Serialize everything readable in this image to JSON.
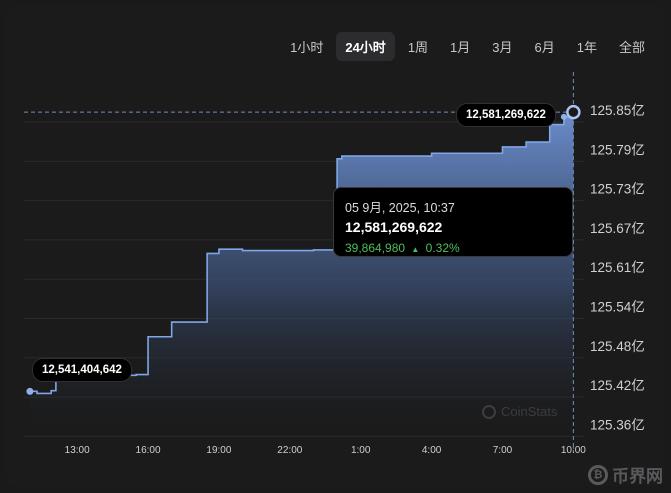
{
  "tabs": [
    {
      "label": "1小时",
      "active": false
    },
    {
      "label": "24小时",
      "active": true
    },
    {
      "label": "1周",
      "active": false
    },
    {
      "label": "1月",
      "active": false
    },
    {
      "label": "3月",
      "active": false
    },
    {
      "label": "6月",
      "active": false
    },
    {
      "label": "1年",
      "active": false
    },
    {
      "label": "全部",
      "active": false
    }
  ],
  "tooltip": {
    "date": "05 9月, 2025, 10:37",
    "value": "12,581,269,622",
    "change_abs": "39,864,980",
    "change_arrow": "▲",
    "change_pct": "0.32%"
  },
  "pills": {
    "current": "12,581,269,622",
    "start": "12,541,404,642"
  },
  "watermark": "CoinStats",
  "brand": "币界网",
  "colors": {
    "line": "#7fa6e6",
    "up": "#4cbf5a",
    "background": "#1b1b1c"
  },
  "chart_data": {
    "type": "area",
    "ytick_labels": [
      "125.85亿",
      "125.79亿",
      "125.73亿",
      "125.67亿",
      "125.61亿",
      "125.54亿",
      "125.48亿",
      "125.42亿",
      "125.36亿"
    ],
    "xtick_labels": [
      "13:00",
      "16:00",
      "19:00",
      "22:00",
      "1:00",
      "4:00",
      "7:00",
      "10:00"
    ],
    "ylim": [
      12535600000,
      12585000000
    ],
    "xlim": [
      -2.25,
      21.45
    ],
    "series": [
      {
        "x": [
          -2.0,
          -1.7,
          -1.1,
          -0.9,
          1.0,
          1.4,
          2.5,
          3.0,
          3.6,
          4.0,
          5.0,
          5.5,
          6.0,
          7.0,
          10.0,
          11.0,
          11.2,
          15.0,
          18.0,
          19.0,
          20.0,
          20.6,
          21.0
        ],
        "y": [
          12541404642,
          12541100000,
          12541500000,
          12543400000,
          12543400000,
          12543700000,
          12543800000,
          12549200000,
          12549200000,
          12551300000,
          12551300000,
          12561100000,
          12561700000,
          12561500000,
          12561600000,
          12574600000,
          12575000000,
          12575400000,
          12576300000,
          12577000000,
          12579500000,
          12580600000,
          12581269622
        ]
      }
    ]
  }
}
